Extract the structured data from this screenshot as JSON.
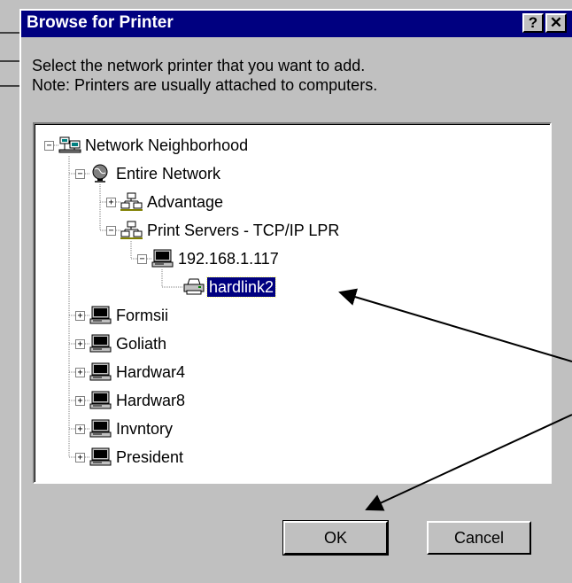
{
  "dialog": {
    "title": "Browse for Printer",
    "help_label": "?",
    "close_label": "✕",
    "instruction_line1": "Select the network printer that you want to add.",
    "instruction_line2": "Note: Printers are usually attached to computers.",
    "ok_label": "OK",
    "cancel_label": "Cancel"
  },
  "tree": {
    "nodes": [
      {
        "label": "Network Neighborhood",
        "icon": "network-neighborhood-icon",
        "expander": "−"
      },
      {
        "label": "Entire Network",
        "icon": "globe-icon",
        "expander": "−"
      },
      {
        "label": "Advantage",
        "icon": "network-group-icon",
        "expander": "+"
      },
      {
        "label": "Print Servers - TCP/IP LPR",
        "icon": "network-group-icon",
        "expander": "−"
      },
      {
        "label": "192.168.1.117",
        "icon": "computer-icon",
        "expander": "−"
      },
      {
        "label": "hardlink2",
        "icon": "printer-icon",
        "expander": "",
        "selected": true
      },
      {
        "label": "Formsii",
        "icon": "computer-icon",
        "expander": "+"
      },
      {
        "label": "Goliath",
        "icon": "computer-icon",
        "expander": "+"
      },
      {
        "label": "Hardwar4",
        "icon": "computer-icon",
        "expander": "+"
      },
      {
        "label": "Hardwar8",
        "icon": "computer-icon",
        "expander": "+"
      },
      {
        "label": "Invntory",
        "icon": "computer-icon",
        "expander": "+"
      },
      {
        "label": "President",
        "icon": "computer-icon",
        "expander": "+"
      }
    ]
  },
  "colors": {
    "titlebar": "#000080",
    "face": "#c0c0c0",
    "selection": "#000080"
  }
}
